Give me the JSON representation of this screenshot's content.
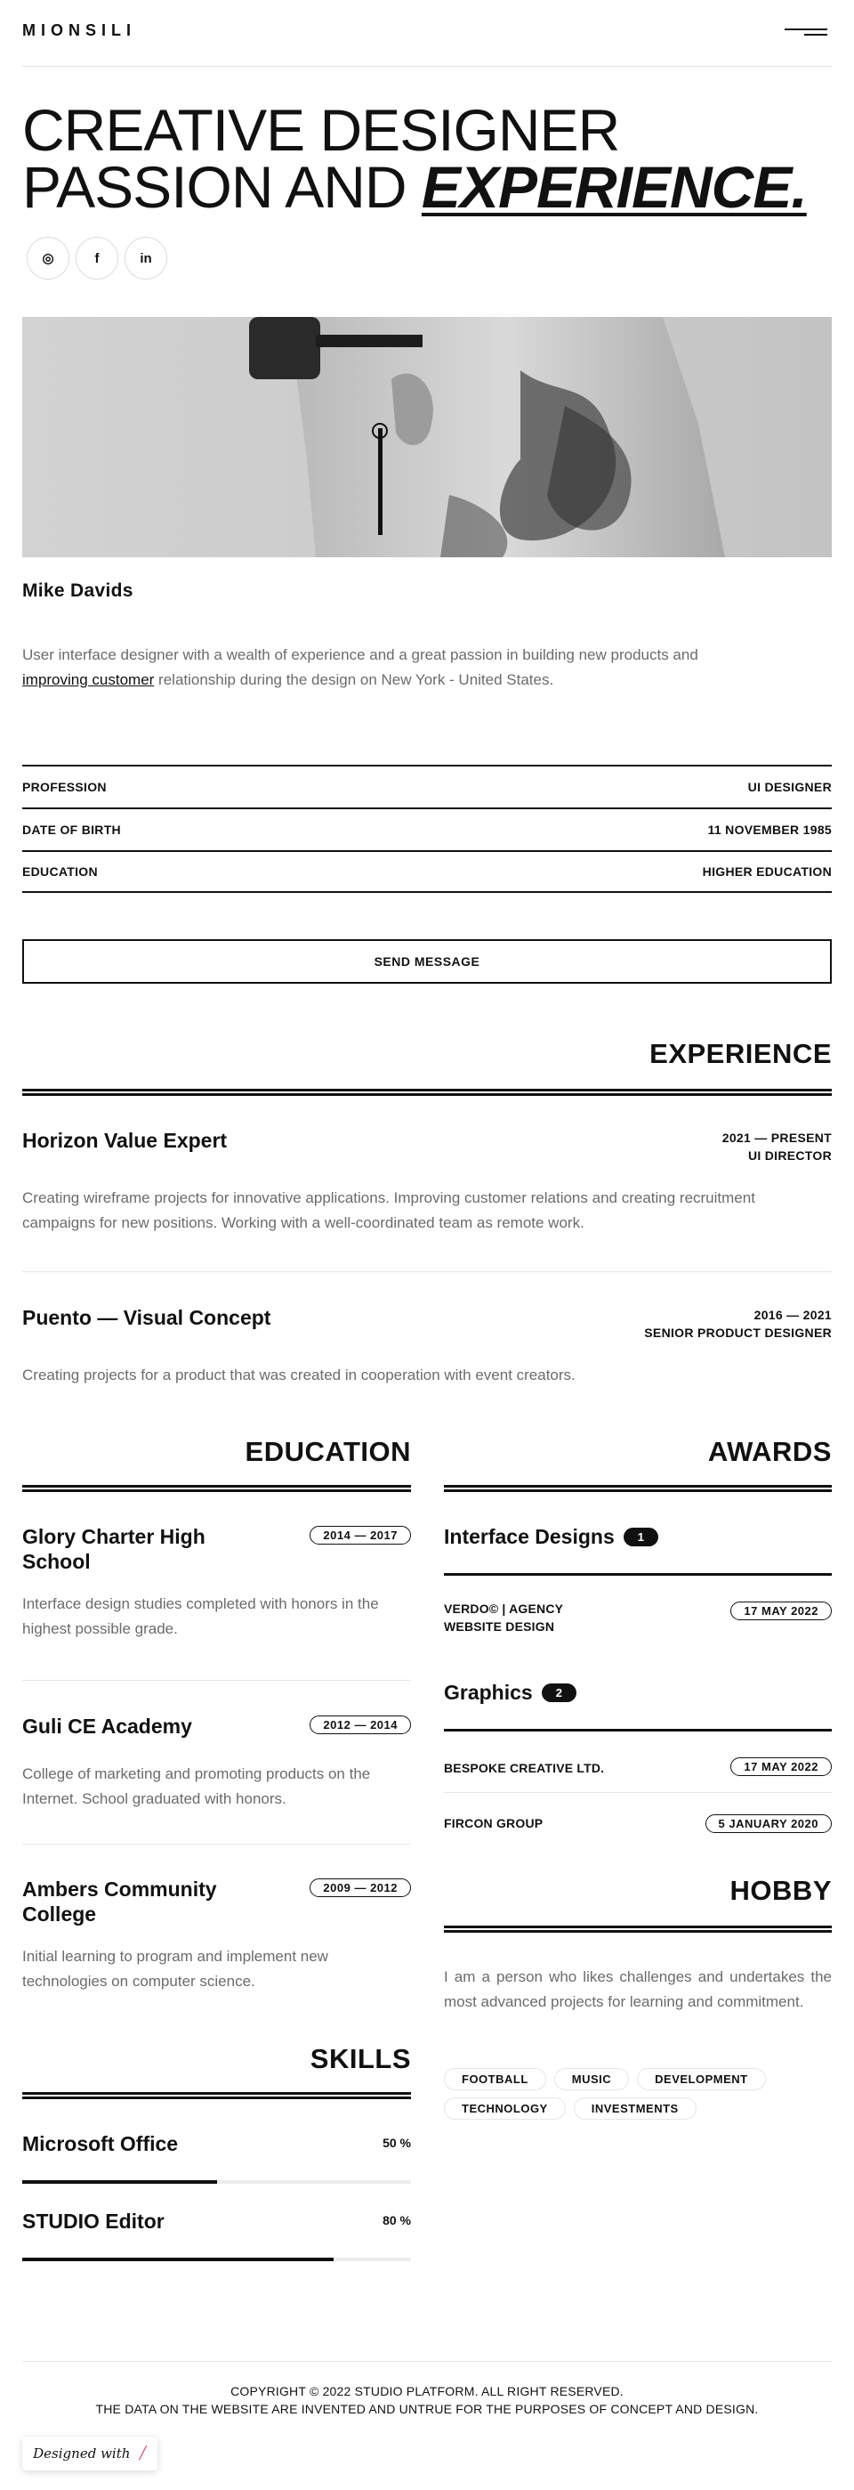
{
  "header": {
    "logo": "MIONSILI",
    "menu_icon": "hamburger-icon"
  },
  "hero": {
    "line1": "CREATIVE DESIGNER",
    "line2_plain": "PASSION AND ",
    "line2_emphasis": "EXPERIENCE.",
    "socials": [
      {
        "icon": "instagram-icon",
        "glyph": "◎"
      },
      {
        "icon": "facebook-icon",
        "glyph": "f"
      },
      {
        "icon": "linkedin-icon",
        "glyph": "in"
      }
    ]
  },
  "profile": {
    "name": "Mike Davids",
    "bio_before": "User interface designer with a wealth of experience and a great passion in building new products and ",
    "bio_link": "improving customer",
    "bio_after": " relationship during the design on New York - United States.",
    "info": [
      {
        "label": "PROFESSION",
        "value": "UI DESIGNER"
      },
      {
        "label": "DATE OF BIRTH",
        "value": "11 NOVEMBER 1985"
      },
      {
        "label": "EDUCATION",
        "value": "HIGHER EDUCATION"
      }
    ],
    "send_label": "SEND MESSAGE"
  },
  "experience": {
    "title": "EXPERIENCE",
    "jobs": [
      {
        "title": "Horizon Value Expert",
        "period": "2021 — PRESENT",
        "role": "UI DIRECTOR",
        "desc": "Creating wireframe projects for innovative applications. Improving customer relations and creating recruitment campaigns for new positions. Working with a well-coordinated team as remote work."
      },
      {
        "title": "Puento — Visual Concept",
        "period": "2016 — 2021",
        "role": "SENIOR PRODUCT DESIGNER",
        "desc": "Creating projects for a product that was created in cooperation with event creators."
      }
    ]
  },
  "education": {
    "title": "EDUCATION",
    "items": [
      {
        "school": "Glory Charter High School",
        "years": "2014 — 2017",
        "desc": "Interface design studies completed with honors in the highest possible grade."
      },
      {
        "school": "Guli CE Academy",
        "years": "2012 — 2014",
        "desc": "College of marketing and promoting products on the Internet. School graduated with honors."
      },
      {
        "school": "Ambers Community College",
        "years": "2009 — 2012",
        "desc": "Initial learning to program and implement new technologies on computer science."
      }
    ]
  },
  "awards": {
    "title": "AWARDS",
    "groups": [
      {
        "name": "Interface Designs",
        "count": "1",
        "items": [
          {
            "name": "VERDO© | AGENCY WEBSITE DESIGN",
            "date": "17 MAY 2022"
          }
        ]
      },
      {
        "name": "Graphics",
        "count": "2",
        "items": [
          {
            "name": "BESPOKE CREATIVE LTD.",
            "date": "17 MAY 2022"
          },
          {
            "name": "FIRCON GROUP",
            "date": "5 JANUARY 2020"
          }
        ]
      }
    ]
  },
  "hobby": {
    "title": "HOBBY",
    "text": "I am a person who likes challenges and undertakes the most advanced projects for learning and commitment.",
    "tags": [
      "FOOTBALL",
      "MUSIC",
      "DEVELOPMENT",
      "TECHNOLOGY",
      "INVESTMENTS"
    ]
  },
  "skills": {
    "title": "SKILLS",
    "items": [
      {
        "name": "Microsoft Office",
        "percent_label": "50 %",
        "level": 0.5
      },
      {
        "name": "STUDIO Editor",
        "percent_label": "80 %",
        "level": 0.8
      }
    ]
  },
  "footer": {
    "copyright": "COPYRIGHT © 2022 STUDIO PLATFORM. ALL RIGHT RESERVED.",
    "disclaimer": "THE DATA ON THE WEBSITE ARE INVENTED AND UNTRUE FOR THE PURPOSES OF CONCEPT AND DESIGN.",
    "designed_label": "Designed with"
  }
}
